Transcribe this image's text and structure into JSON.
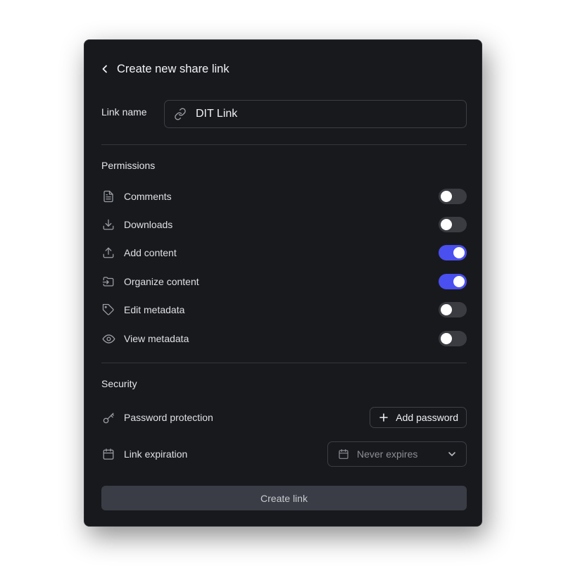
{
  "header": {
    "title": "Create new share link"
  },
  "link_name": {
    "label": "Link name",
    "value": "DIT Link"
  },
  "permissions": {
    "title": "Permissions",
    "items": [
      {
        "label": "Comments",
        "icon": "document-icon",
        "enabled": false
      },
      {
        "label": "Downloads",
        "icon": "download-icon",
        "enabled": false
      },
      {
        "label": "Add content",
        "icon": "upload-icon",
        "enabled": true
      },
      {
        "label": "Organize content",
        "icon": "folder-move-icon",
        "enabled": true
      },
      {
        "label": "Edit metadata",
        "icon": "tag-icon",
        "enabled": false
      },
      {
        "label": "View metadata",
        "icon": "eye-icon",
        "enabled": false
      }
    ]
  },
  "security": {
    "title": "Security",
    "password": {
      "label": "Password protection",
      "button_label": "Add password"
    },
    "expiration": {
      "label": "Link expiration",
      "selected": "Never expires"
    }
  },
  "create_button": {
    "label": "Create link"
  },
  "colors": {
    "panel_bg": "#18191d",
    "toggle_on": "#4a4ff0",
    "toggle_off": "#3a3c42",
    "button_bg": "#3a3d45"
  }
}
